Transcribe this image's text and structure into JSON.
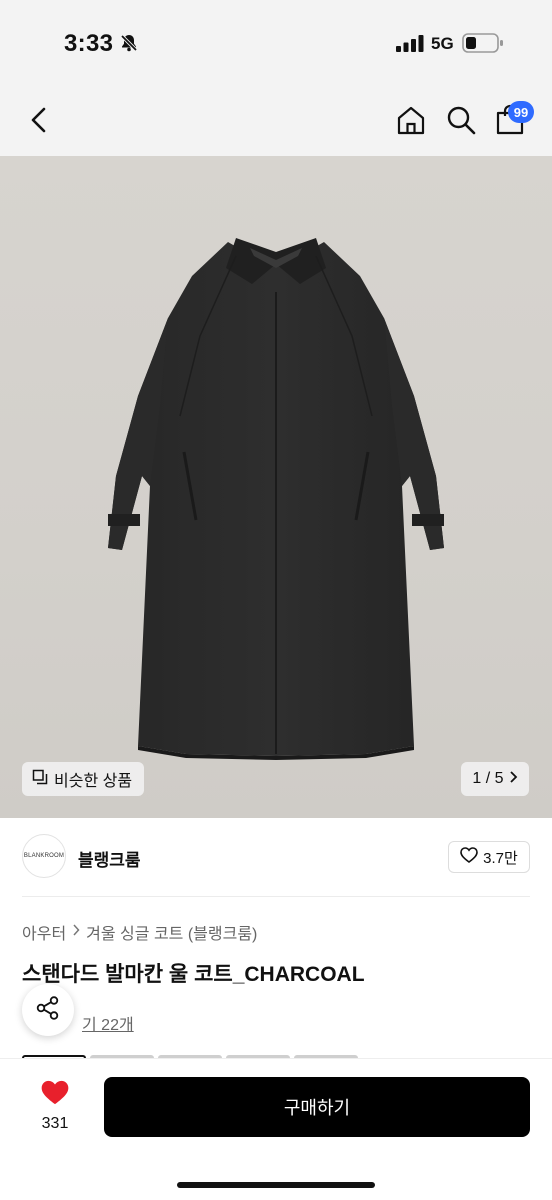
{
  "status_bar": {
    "time": "3:33",
    "network": "5G"
  },
  "header": {
    "cart_badge": "99"
  },
  "hero": {
    "similar_label": "비슷한 상품",
    "page_indicator": "1 / 5"
  },
  "brand": {
    "logo_text": "BLANKROOM",
    "name": "블랭크룸",
    "likes": "3.7만"
  },
  "breadcrumb": {
    "category": "아우터",
    "subcategory": "겨울 싱글 코트 (블랭크룸)"
  },
  "product": {
    "title": "스탠다드 발마칸 울 코트_CHARCOAL",
    "review_text": "기 22개"
  },
  "bottom_bar": {
    "heart_count": "331",
    "buy_label": "구매하기"
  },
  "colors": {
    "accent_blue": "#2f6bff",
    "heart_red": "#e8202c",
    "coat": "#2b2b2b"
  }
}
